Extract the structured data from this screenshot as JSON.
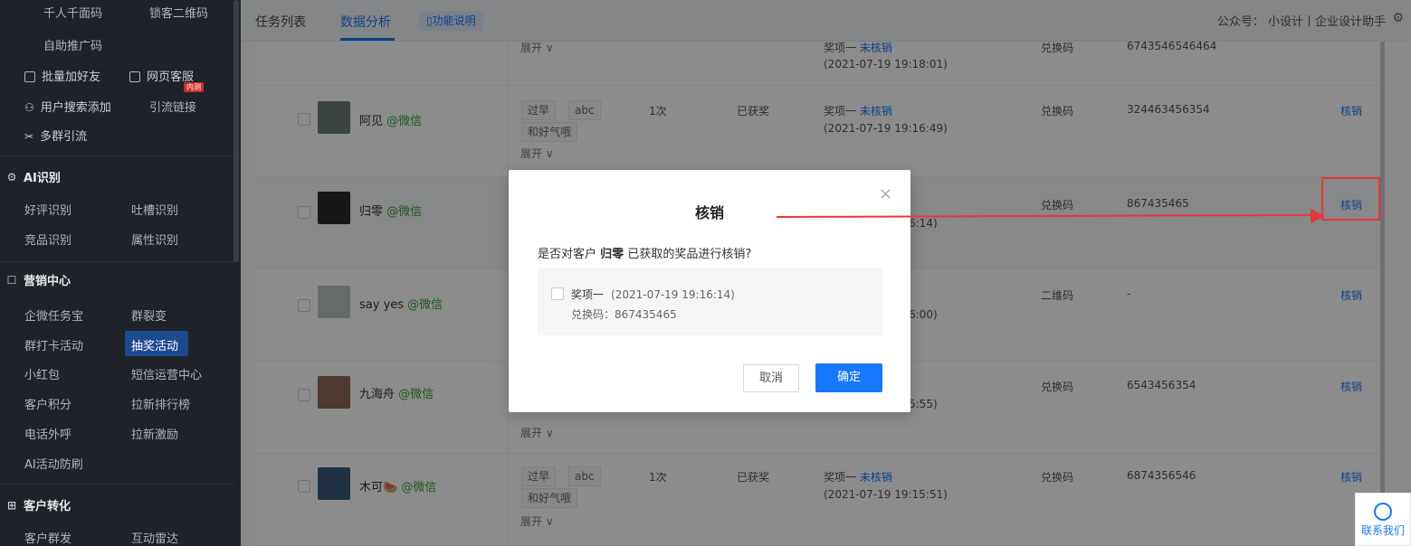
{
  "sidebar": {
    "top_items": [
      {
        "left": "千人千面码",
        "right": "锁客二维码"
      },
      {
        "left": "自助推广码"
      }
    ],
    "rows": [
      {
        "left": "批量加好友",
        "right": "网页客服",
        "badge": "内测"
      },
      {
        "left": "用户搜索添加",
        "right": "引流链接"
      },
      {
        "left": "多群引流"
      }
    ],
    "sections": {
      "ai": {
        "title": "AI识别",
        "items": [
          [
            "好评识别",
            "吐槽识别"
          ],
          [
            "竞品识别",
            "属性识别"
          ]
        ]
      },
      "marketing": {
        "title": "营销中心",
        "items": [
          [
            "企微任务宝",
            "群裂变"
          ],
          [
            "群打卡活动",
            "抽奖活动"
          ],
          [
            "小红包",
            "短信运营中心"
          ],
          [
            "客户积分",
            "拉新排行榜"
          ],
          [
            "电话外呼",
            "拉新激励"
          ],
          [
            "AI活动防刷"
          ]
        ]
      },
      "conversion": {
        "title": "客户转化",
        "items": [
          [
            "客户群发",
            "互动雷达"
          ]
        ]
      }
    }
  },
  "topbar": {
    "tabs": [
      "任务列表",
      "数据分析"
    ],
    "help": "功能说明",
    "gzh": "公众号： 小设计丨企业设计助手"
  },
  "rows": [
    {
      "name": "",
      "wx": "",
      "tags": [],
      "expand": "展开 ∨",
      "count": "",
      "status": "",
      "prize": "奖项一",
      "prize_state": "未核销",
      "time": "(2021-07-19 19:18:01)",
      "type": "兑换码",
      "code": "6743546546464",
      "action": ""
    },
    {
      "name": "阿见",
      "wx": "@微信",
      "tags": [
        "过早",
        "abc",
        "和好气哦"
      ],
      "expand": "展开 ∨",
      "count": "1次",
      "status": "已获奖",
      "prize": "奖项一",
      "prize_state": "未核销",
      "time": "(2021-07-19 19:16:49)",
      "type": "兑换码",
      "code": "324463456354",
      "action": "核销"
    },
    {
      "name": "归零",
      "wx": "@微信",
      "tags": [],
      "expand": "",
      "count": "",
      "status": "",
      "prize": "",
      "prize_state": "",
      "time": "6:14)",
      "type": "兑换码",
      "code": "867435465",
      "action": "核销"
    },
    {
      "name": "say yes",
      "wx": "@微信",
      "tags": [],
      "expand": "",
      "count": "",
      "status": "",
      "prize": "",
      "prize_state": "",
      "time": "6:00)",
      "type": "二维码",
      "code": "-",
      "action": "核销"
    },
    {
      "name": "九海舟",
      "wx": "@微信",
      "tags": [],
      "expand": "展开 ∨",
      "count": "",
      "status": "",
      "prize": "",
      "prize_state": "",
      "time": "5:55)",
      "type": "兑换码",
      "code": "6543456354",
      "action": "核销"
    },
    {
      "name": "木可🍉",
      "wx": "@微信",
      "tags": [
        "过早",
        "abc",
        "和好气哦"
      ],
      "expand": "展开 ∨",
      "count": "1次",
      "status": "已获奖",
      "prize": "奖项一",
      "prize_state": "未核销",
      "time": "(2021-07-19 19:15:51)",
      "type": "兑换码",
      "code": "6874356546",
      "action": "核销"
    }
  ],
  "modal": {
    "title": "核销",
    "close": "×",
    "question_pre": "是否对客户",
    "customer": "归零",
    "question_post": "已获取的奖品进行核销?",
    "prize_name": "奖项一",
    "prize_time": "(2021-07-19 19:16:14)",
    "prize_code": "兑换码：867435465",
    "cancel": "取消",
    "confirm": "确定"
  },
  "contact": "联系我们",
  "colors": {
    "primary": "#1677ff",
    "sidebar": "#1f2329",
    "annotation": "#e53935",
    "wechat": "#3a9e3a"
  }
}
